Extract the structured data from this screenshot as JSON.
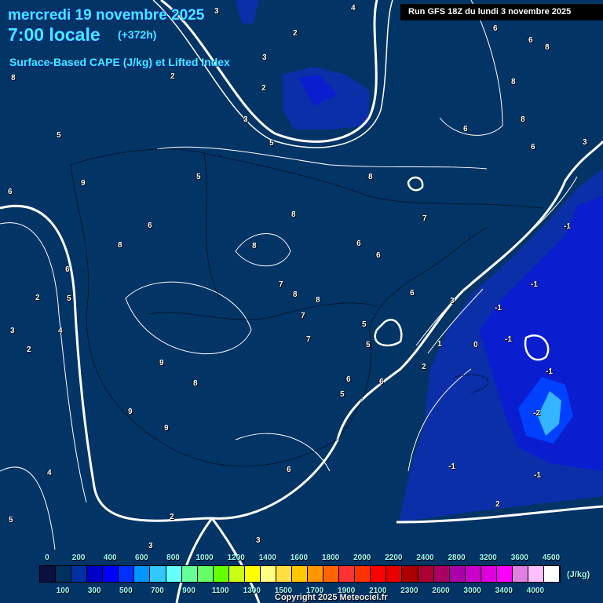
{
  "header": {
    "date": "mercredi 19 novembre 2025",
    "time": "7:00 locale",
    "offset": "(+372h)",
    "parameter": "Surface-Based CAPE (J/kg) et Lifted Index",
    "run": "Run GFS 18Z du lundi 3 novembre 2025"
  },
  "map": {
    "background": "#023466",
    "labels": [
      "3",
      "4",
      "2",
      "3",
      "2",
      "2",
      "3",
      "8",
      "5",
      "6",
      "5",
      "9",
      "6",
      "8",
      "6",
      "2",
      "5",
      "3",
      "4",
      "2",
      "9",
      "8",
      "9",
      "9",
      "8",
      "8",
      "7",
      "8",
      "7",
      "8",
      "6",
      "6",
      "7",
      "6",
      "5",
      "5",
      "5",
      "6",
      "6",
      "3",
      "1",
      "2",
      "0",
      "-1",
      "-1",
      "-1",
      "-2",
      "-1",
      "-1",
      "-1",
      "-1",
      "2",
      "6",
      "3",
      "2",
      "3",
      "5",
      "4",
      "6",
      "6",
      "8",
      "8",
      "8",
      "6",
      "8",
      "7",
      "6",
      "3",
      "5"
    ]
  },
  "legend": {
    "unit": "(J/kg)",
    "top_labels": [
      "0",
      "200",
      "400",
      "600",
      "800",
      "1000",
      "1200",
      "1400",
      "1600",
      "1800",
      "2000",
      "2200",
      "2400",
      "2800",
      "3200",
      "3600",
      "4500"
    ],
    "bottom_labels": [
      "100",
      "300",
      "500",
      "700",
      "900",
      "1100",
      "1300",
      "1500",
      "1700",
      "1900",
      "2100",
      "2300",
      "2600",
      "3000",
      "3400",
      "4000"
    ],
    "colors": [
      "#0a1040",
      "#00305e",
      "#0030a0",
      "#0000c8",
      "#0000ff",
      "#0030ff",
      "#0096ff",
      "#30c8ff",
      "#64ffff",
      "#64ff96",
      "#64ff64",
      "#64ff00",
      "#c8ff14",
      "#ffff00",
      "#ffff80",
      "#ffe040",
      "#ffc800",
      "#ff9600",
      "#ff6400",
      "#ff3232",
      "#ff3200",
      "#ff0000",
      "#e60000",
      "#aa0000",
      "#aa0032",
      "#aa0064",
      "#aa00aa",
      "#c800c8",
      "#dc00dc",
      "#ff00ff",
      "#e080e0",
      "#ffc0ff",
      "#ffffff"
    ]
  },
  "copyright": "Copyright 2025 Meteociel.fr"
}
